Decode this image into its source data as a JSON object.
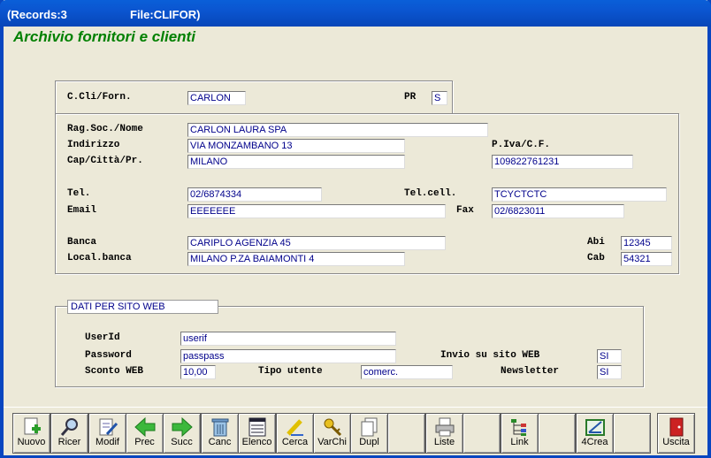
{
  "titlebar": {
    "records": "(Records:3",
    "file": "File:CLIFOR)"
  },
  "heading": "Archivio fornitori e clienti",
  "top": {
    "code_label": "C.Cli/Forn.",
    "code_value": "CARLON",
    "pr_label": "PR",
    "pr_value": "S"
  },
  "main": {
    "ragsoc_label": "Rag.Soc./Nome",
    "ragsoc_value": "CARLON LAURA SPA",
    "indirizzo_label": "Indirizzo",
    "indirizzo_value": "VIA MONZAMBANO 13",
    "piva_label": "P.Iva/C.F.",
    "piva_value": "109822761231",
    "cap_label": "Cap/Città/Pr.",
    "cap_value": "MILANO",
    "tel_label": "Tel.",
    "tel_value": "02/6874334",
    "telcell_label": "Tel.cell.",
    "telcell_value": "TCYCTCTC",
    "email_label": "Email",
    "email_value": "EEEEEEE",
    "fax_label": "Fax",
    "fax_value": "02/6823011",
    "banca_label": "Banca",
    "banca_value": "CARIPLO AGENZIA 45",
    "abi_label": "Abi",
    "abi_value": "12345",
    "localbanca_label": "Local.banca",
    "localbanca_value": "MILANO P.ZA BAIAMONTI 4",
    "cab_label": "Cab",
    "cab_value": "54321"
  },
  "web": {
    "title": "DATI PER SITO WEB",
    "userid_label": "UserId",
    "userid_value": "userif",
    "password_label": "Password",
    "password_value": "passpass",
    "invio_label": "Invio su sito WEB",
    "invio_value": "SI",
    "sconto_label": "Sconto WEB",
    "sconto_value": "10,00",
    "tipo_label": "Tipo utente",
    "tipo_value": "comerc.",
    "newsletter_label": "Newsletter",
    "newsletter_value": "SI"
  },
  "toolbar": {
    "nuovo": "Nuovo",
    "ricer": "Ricer",
    "modif": "Modif",
    "prec": "Prec",
    "succ": "Succ",
    "canc": "Canc",
    "elenco": "Elenco",
    "cerca": "Cerca",
    "varchi": "VarChi",
    "dupl": "Dupl",
    "liste": "Liste",
    "link": "Link",
    "crea": "4Crea",
    "uscita": "Uscita"
  },
  "colors": {
    "titlebar": "#0b55d0",
    "heading": "#008000",
    "field_text": "#00008b",
    "background": "#ece9d8"
  }
}
